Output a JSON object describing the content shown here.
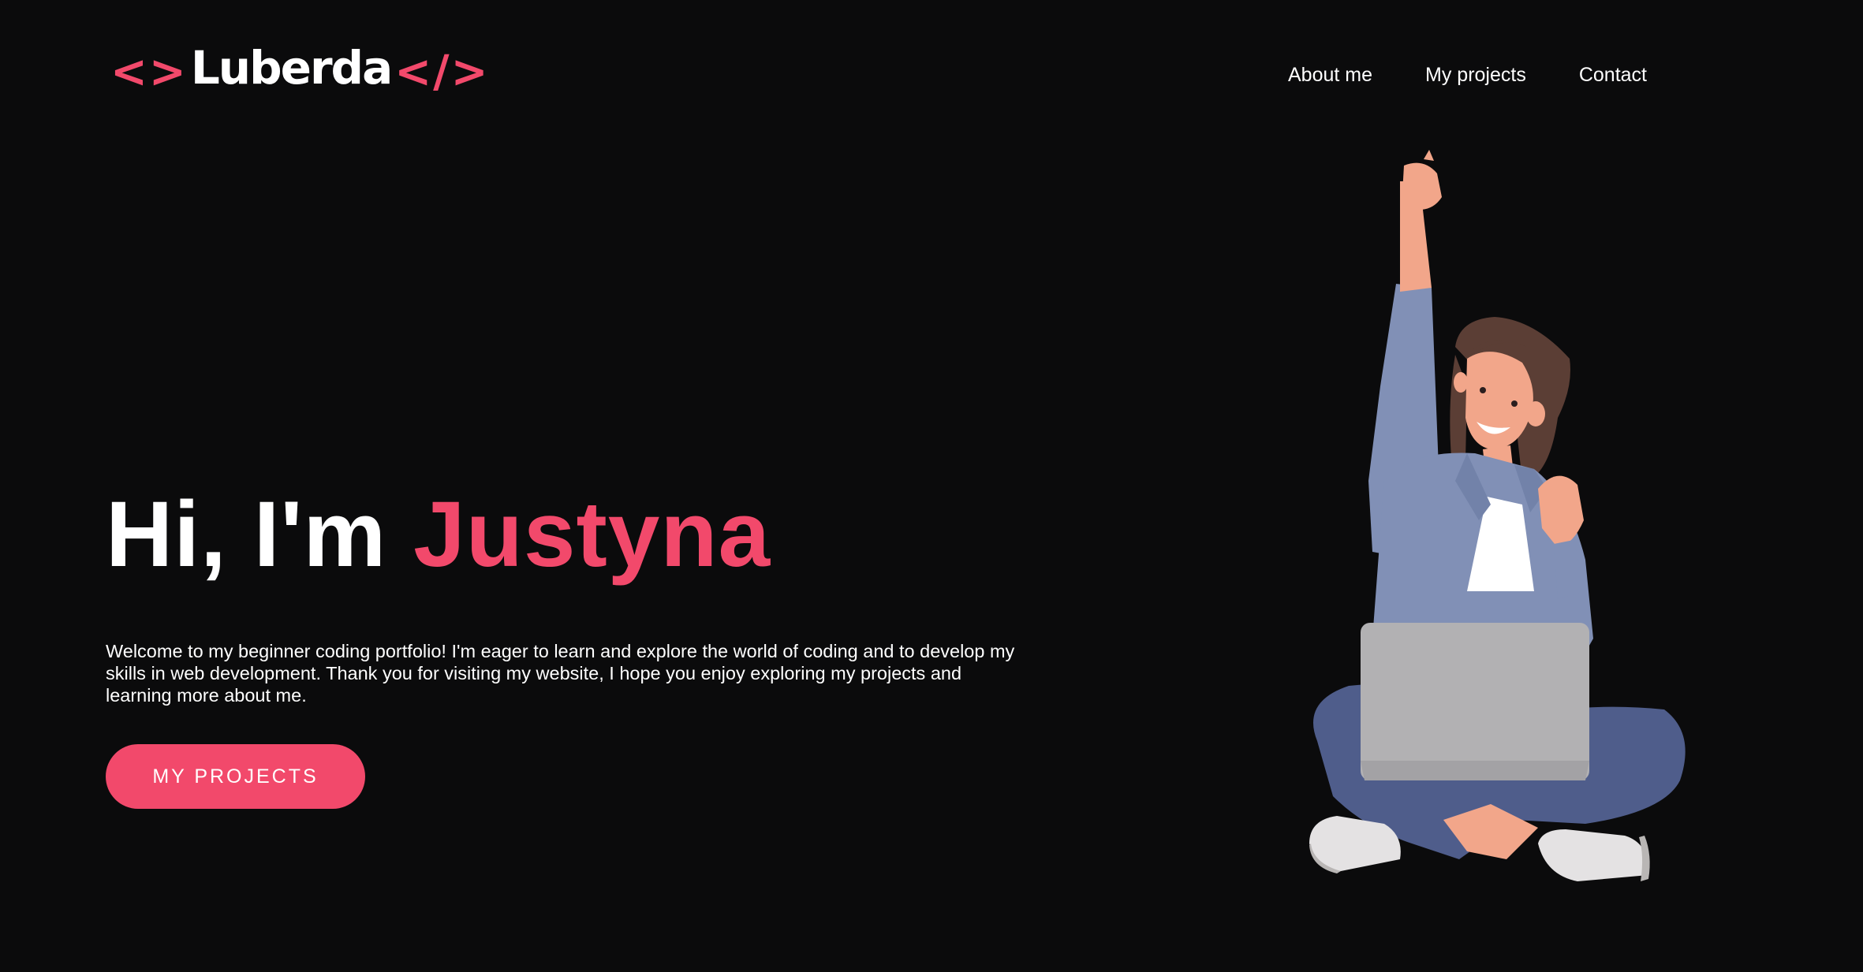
{
  "logo": {
    "open_bracket": "<>",
    "brand": "Luberda",
    "close_bracket": "</>"
  },
  "nav": {
    "items": [
      {
        "label": "About me"
      },
      {
        "label": "My projects"
      },
      {
        "label": "Contact"
      }
    ]
  },
  "hero": {
    "greeting": "Hi, I'm ",
    "name": "Justyna",
    "intro": "Welcome to my beginner coding portfolio! I'm eager to learn and explore the world of coding and to develop my skills in web development. Thank you for visiting my website, I hope you enjoy exploring my projects and learning more about me.",
    "cta_label": "MY PROJECTS"
  },
  "colors": {
    "background": "#0b0b0c",
    "accent": "#f2496b",
    "text": "#ffffff"
  },
  "illustration": {
    "icon": "woman-with-laptop-cheering-illustration"
  }
}
